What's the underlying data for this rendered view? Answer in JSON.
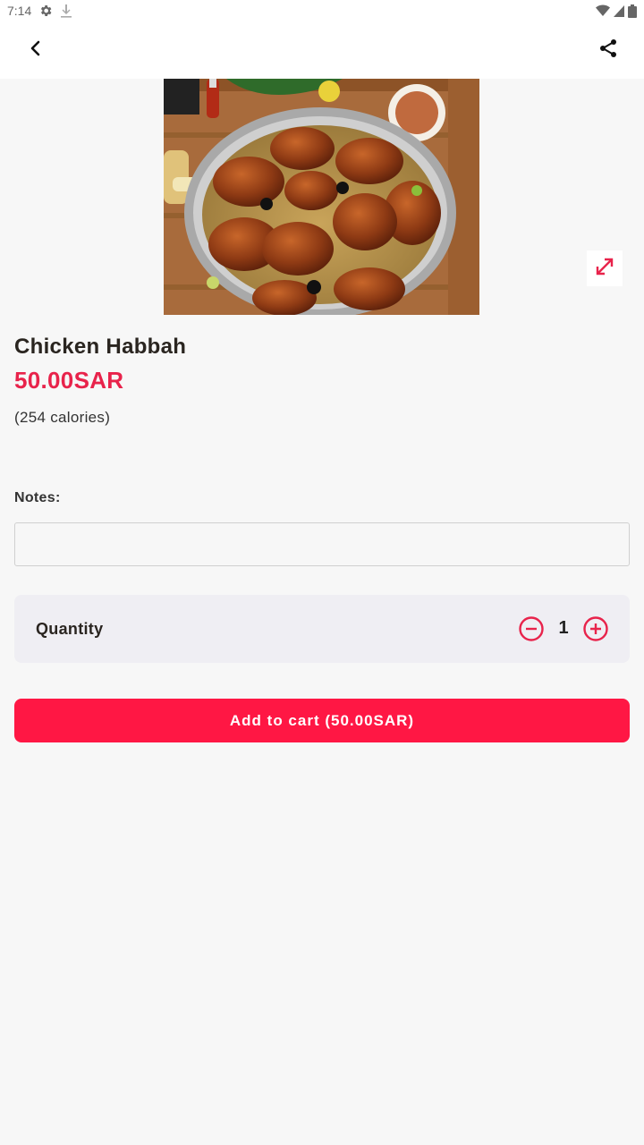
{
  "status_bar": {
    "time": "7:14",
    "icons": [
      "settings-icon",
      "download-icon",
      "wifi-icon",
      "signal-icon",
      "battery-icon"
    ]
  },
  "app_bar": {
    "back_icon": "chevron-left-icon",
    "share_icon": "share-icon"
  },
  "product": {
    "name": "Chicken Habbah",
    "price": "50.00SAR",
    "calories": "(254 calories)",
    "image_icon": "expand-icon"
  },
  "notes": {
    "label": "Notes:",
    "value": "",
    "placeholder": ""
  },
  "quantity": {
    "label": "Quantity",
    "value": "1"
  },
  "cart": {
    "button_label": "Add to cart (50.00SAR)"
  },
  "colors": {
    "accent": "#ff1744",
    "price": "#e8234b",
    "background": "#f7f7f7",
    "quantity_card": "#efeef3"
  }
}
